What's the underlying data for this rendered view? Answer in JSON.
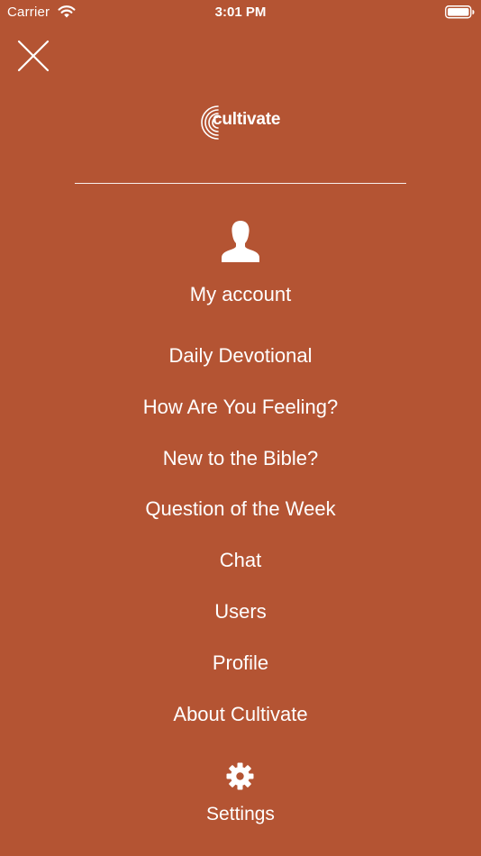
{
  "status_bar": {
    "carrier": "Carrier",
    "time": "3:01 PM"
  },
  "header": {
    "close_icon": "close-icon",
    "logo_text": "cultivate"
  },
  "account": {
    "icon": "user-silhouette-icon",
    "label": "My account"
  },
  "menu": {
    "items": [
      {
        "label": "Daily Devotional"
      },
      {
        "label": "How Are You Feeling?"
      },
      {
        "label": "New to the Bible?"
      },
      {
        "label": "Question of the Week"
      },
      {
        "label": "Chat"
      },
      {
        "label": "Users"
      },
      {
        "label": "Profile"
      },
      {
        "label": "About Cultivate"
      }
    ]
  },
  "settings": {
    "icon": "gear-icon",
    "label": "Settings"
  },
  "colors": {
    "background": "#b45433",
    "foreground": "#ffffff"
  }
}
